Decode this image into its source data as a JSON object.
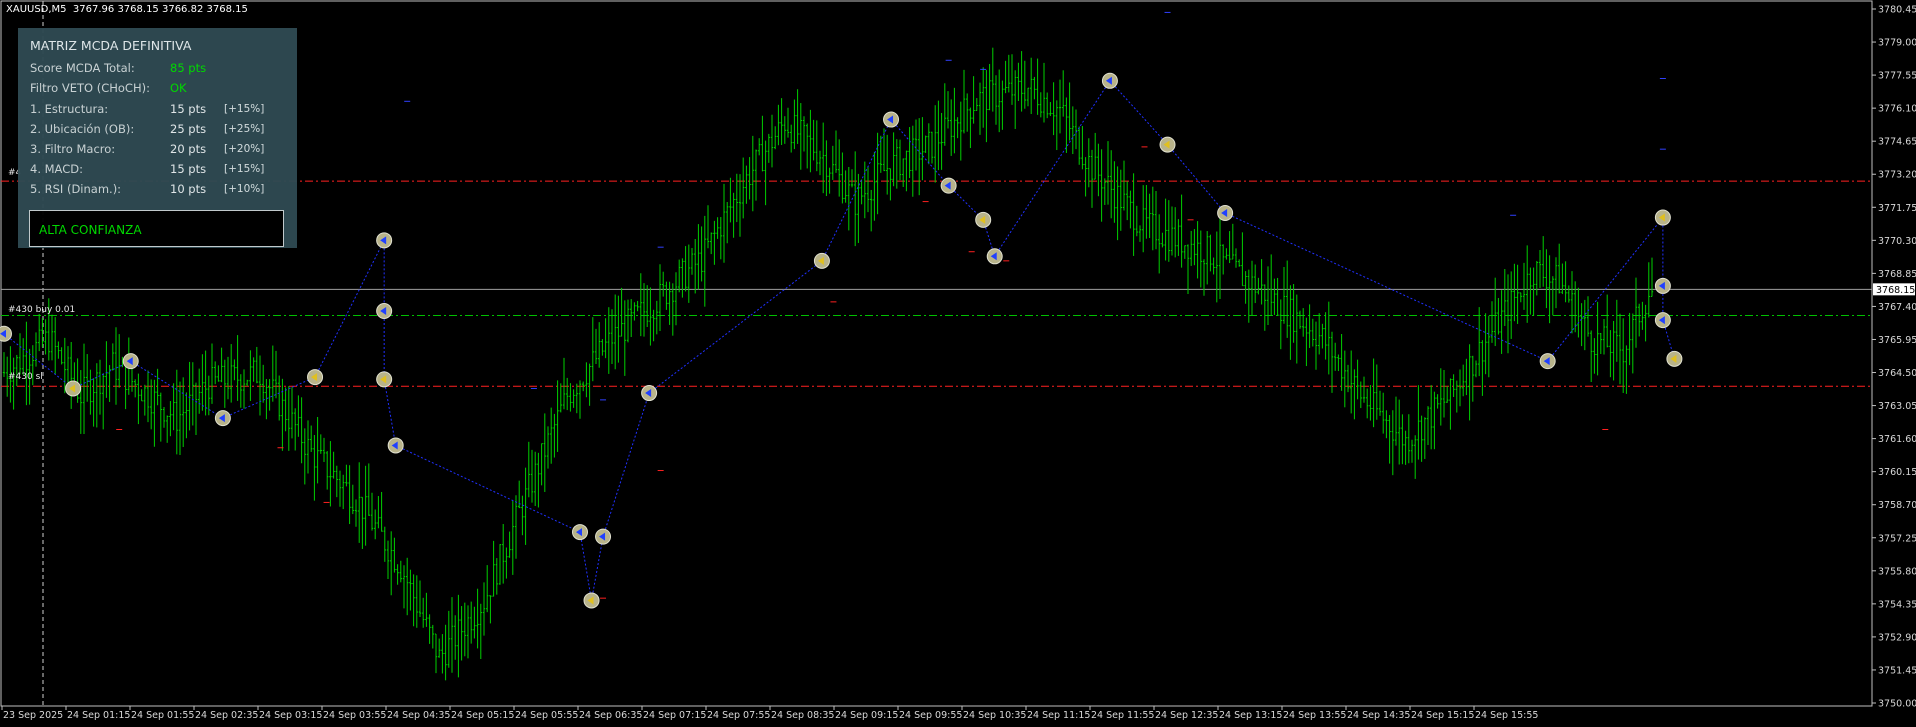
{
  "header": {
    "symbol": "XAUUSD,M5",
    "ohlc": "3767.96 3768.15 3766.82 3768.15"
  },
  "panel": {
    "title": "MATRIZ MCDA DEFINITIVA",
    "score_label": "Score MCDA Total:",
    "score_value": "85 pts",
    "veto_label": "Filtro VETO (CHoCH):",
    "veto_value": "OK",
    "criteria": [
      {
        "label": "1. Estructura:",
        "value": "15 pts",
        "weight": "[+15%]"
      },
      {
        "label": "2. Ubicación (OB):",
        "value": "25 pts",
        "weight": "[+25%]"
      },
      {
        "label": "3. Filtro Macro:",
        "value": "20 pts",
        "weight": "[+20%]"
      },
      {
        "label": "4. MACD:",
        "value": "15 pts",
        "weight": "[+15%]"
      },
      {
        "label": "5. RSI (Dinam.):",
        "value": "10 pts",
        "weight": "[+10%]"
      }
    ],
    "confidence": "ALTA CONFIANZA"
  },
  "trades": {
    "buy_label": "#430 buy 0.01",
    "sl_label": "#430 sl",
    "tp_label": "#4"
  },
  "colors": {
    "background": "#000000",
    "candle": "#00d000",
    "grid_border": "#c0c0c0",
    "tp_sl_line": "#ff2020",
    "entry_line": "#00c000",
    "bid_line": "#a0a0a0",
    "swing_line": "#2030ff",
    "panel_bg": "#2f4a52",
    "positive_text": "#00e000"
  },
  "chart_data": {
    "type": "candlestick",
    "ylim": [
      3750.0,
      3780.45
    ],
    "y_ticks": [
      "3780.45",
      "3779.00",
      "3777.55",
      "3776.10",
      "3774.65",
      "3773.20",
      "3771.75",
      "3770.30",
      "3768.85",
      "3767.40",
      "3765.95",
      "3764.50",
      "3763.05",
      "3761.60",
      "3760.15",
      "3758.70",
      "3757.25",
      "3755.80",
      "3754.35",
      "3752.90",
      "3751.45",
      "3750.00"
    ],
    "x_labels": [
      "23 Sep 2025",
      "24 Sep 01:15",
      "24 Sep 01:55",
      "24 Sep 02:35",
      "24 Sep 03:15",
      "24 Sep 03:55",
      "24 Sep 04:35",
      "24 Sep 05:15",
      "24 Sep 05:55",
      "24 Sep 06:35",
      "24 Sep 07:15",
      "24 Sep 07:55",
      "24 Sep 08:35",
      "24 Sep 09:15",
      "24 Sep 09:55",
      "24 Sep 10:35",
      "24 Sep 11:15",
      "24 Sep 11:55",
      "24 Sep 12:35",
      "24 Sep 13:15",
      "24 Sep 13:55",
      "24 Sep 14:35",
      "24 Sep 15:15",
      "24 Sep 15:55"
    ],
    "current_price": "3768.15",
    "levels": {
      "take_profit": 3772.9,
      "entry": 3767.0,
      "stop_loss": 3763.9,
      "bid": 3768.15
    },
    "path": [
      [
        0,
        3764.5
      ],
      [
        14,
        3766.0
      ],
      [
        24,
        3763.5
      ],
      [
        34,
        3764.8
      ],
      [
        54,
        3762.5
      ],
      [
        64,
        3764.0
      ],
      [
        80,
        3764.5
      ],
      [
        96,
        3761.0
      ],
      [
        110,
        3759.0
      ],
      [
        124,
        3756.0
      ],
      [
        136,
        3752.0
      ],
      [
        150,
        3754.5
      ],
      [
        160,
        3758.0
      ],
      [
        176,
        3763.5
      ],
      [
        190,
        3766.0
      ],
      [
        205,
        3767.8
      ],
      [
        218,
        3769.5
      ],
      [
        232,
        3773.0
      ],
      [
        244,
        3775.5
      ],
      [
        256,
        3774.0
      ],
      [
        266,
        3772.0
      ],
      [
        276,
        3773.5
      ],
      [
        290,
        3774.5
      ],
      [
        304,
        3776.5
      ],
      [
        320,
        3777.0
      ],
      [
        330,
        3776.0
      ],
      [
        340,
        3773.5
      ],
      [
        356,
        3771.0
      ],
      [
        376,
        3769.8
      ],
      [
        394,
        3768.0
      ],
      [
        412,
        3766.0
      ],
      [
        424,
        3763.5
      ],
      [
        438,
        3761.5
      ],
      [
        452,
        3763.5
      ],
      [
        466,
        3766.5
      ],
      [
        478,
        3769.0
      ],
      [
        486,
        3768.5
      ],
      [
        496,
        3766.0
      ],
      [
        506,
        3765.5
      ],
      [
        514,
        3768.0
      ]
    ],
    "swing_points": [
      [
        0,
        3766.2
      ],
      [
        6,
        3763.8
      ],
      [
        11,
        3765.0
      ],
      [
        19,
        3762.5
      ],
      [
        27,
        3764.3
      ],
      [
        33,
        3770.3
      ],
      [
        33,
        3767.2
      ],
      [
        33,
        3764.2
      ],
      [
        34,
        3761.3
      ],
      [
        50,
        3757.5
      ],
      [
        51,
        3754.5
      ],
      [
        52,
        3757.3
      ],
      [
        56,
        3763.6
      ],
      [
        71,
        3769.4
      ],
      [
        77,
        3775.6
      ],
      [
        82,
        3772.7
      ],
      [
        85,
        3771.2
      ],
      [
        86,
        3769.6
      ],
      [
        96,
        3777.3
      ],
      [
        101,
        3774.5
      ],
      [
        106,
        3771.5
      ],
      [
        134,
        3765.0
      ],
      [
        144,
        3771.3
      ],
      [
        144,
        3768.3
      ],
      [
        144,
        3766.8
      ],
      [
        145,
        3765.1
      ]
    ],
    "series": []
  }
}
